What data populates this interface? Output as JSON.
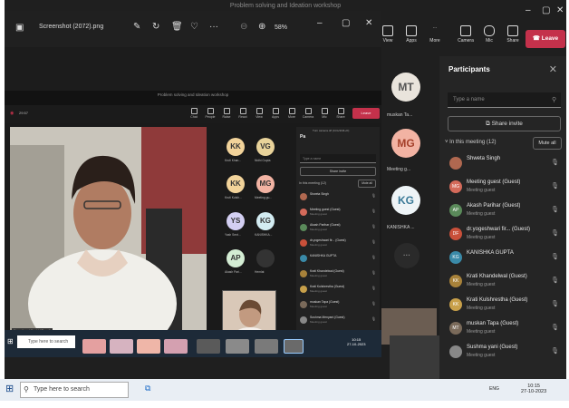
{
  "teams": {
    "title": "Problem solving and Ideation workshop",
    "toolbar": [
      {
        "label": "View"
      },
      {
        "label": "Apps"
      },
      {
        "label": "More"
      },
      {
        "label": "Camera"
      },
      {
        "label": "Mic"
      },
      {
        "label": "Share"
      }
    ],
    "leave": "Leave"
  },
  "big_avatars": [
    {
      "initials": "MT",
      "name": "muskan Ta...",
      "color": "#e9e4dc"
    },
    {
      "initials": "MG",
      "name": "Meeting g...",
      "color": "#f2b3a3"
    },
    {
      "initials": "KG",
      "name": "KANISHKA ...",
      "color": "#eef4f7"
    }
  ],
  "participants": {
    "title": "Participants",
    "search_placeholder": "Type a name",
    "share_invite": "Share invite",
    "in_meeting": "In this meeting (12)",
    "mute_all": "Mute all",
    "rows": [
      {
        "name": "Shweta Singh",
        "role": "",
        "initials": "",
        "color": "#b06850"
      },
      {
        "name": "Meeting guest (Guest)",
        "role": "Meeting guest",
        "initials": "MG",
        "color": "#d46a5a"
      },
      {
        "name": "Akash Parihar (Guest)",
        "role": "Meeting guest",
        "initials": "AP",
        "color": "#5a8a5a"
      },
      {
        "name": "dr.yogeshwari fir... (Guest)",
        "role": "Meeting guest",
        "initials": "DF",
        "color": "#c9503a"
      },
      {
        "name": "KANISHKA GUPTA",
        "role": "",
        "initials": "KG",
        "color": "#3a8aa8"
      },
      {
        "name": "Krati Khandelwal (Guest)",
        "role": "Meeting guest",
        "initials": "KK",
        "color": "#a8823a"
      },
      {
        "name": "Krati Kulshrestha (Guest)",
        "role": "Meeting guest",
        "initials": "KK",
        "color": "#c8a04a"
      },
      {
        "name": "muskan Tapa (Guest)",
        "role": "Meeting guest",
        "initials": "MT",
        "color": "#7a6a5a"
      },
      {
        "name": "Sushma yani (Guest)",
        "role": "Meeting guest",
        "initials": "",
        "color": "#888"
      }
    ]
  },
  "photos": {
    "filename": "Screenshot (2072).png",
    "zoom": "58%"
  },
  "inner": {
    "title": "Problem solving and Ideation workshop",
    "time": "29:57",
    "toolbar": [
      "Chat",
      "People",
      "Raise",
      "React",
      "View",
      "Apps",
      "More",
      "Camera",
      "Mic",
      "Share"
    ],
    "leave": "Leave",
    "video_name": "Yogeshwari Yogisi (Guest)",
    "avatars": [
      {
        "initials": "KK",
        "name": "Kruti Khan...",
        "color": "#f2d39a"
      },
      {
        "initials": "VG",
        "name": "Nidhi Gupta",
        "color": "#e9d39a"
      },
      {
        "initials": "KK",
        "name": "Kruti Kulsh...",
        "color": "#f2d39a"
      },
      {
        "initials": "MG",
        "name": "Meeting gu...",
        "color": "#f2b3a3"
      },
      {
        "initials": "YS",
        "name": "Yash Sent...",
        "color": "#d3cff2"
      },
      {
        "initials": "KG",
        "name": "KANISHKA...",
        "color": "#d3ecf2"
      },
      {
        "initials": "AP",
        "name": "Akash Pari...",
        "color": "#d3ecd3"
      },
      {
        "initials": "",
        "name": "Hemlat",
        "color": "#333"
      }
    ],
    "panel": {
      "header": "Turn camera off (Ctrl+Shift+O)",
      "title": "Pa",
      "search": "Type a name",
      "invite": "Share invite",
      "in_meeting": "In this meeting (12)",
      "mute_all": "Mute all",
      "rows": [
        {
          "name": "Shweta Singh",
          "role": ""
        },
        {
          "name": "Meeting guest (Guest)",
          "role": "Meeting guest"
        },
        {
          "name": "Akash Parihar (Guest)",
          "role": "Meeting guest"
        },
        {
          "name": "dr.yogeshwari fir... (Guest)",
          "role": "Meeting guest"
        },
        {
          "name": "KANISHKA GUPTA",
          "role": ""
        },
        {
          "name": "Krati Khandelwal (Guest)",
          "role": "Meeting guest"
        },
        {
          "name": "Krati Kulshrestha (Guest)",
          "role": "Meeting guest"
        },
        {
          "name": "muskan Tapa (Guest)",
          "role": "Meeting guest"
        },
        {
          "name": "Sushma Menyani (Guest)",
          "role": "Meeting guest"
        }
      ]
    },
    "taskbar_search": "Type here to search",
    "clock": "10:15",
    "date": "27-10-2023"
  },
  "outer_taskbar": {
    "search": "Type here to search",
    "lang": "ENG",
    "time": "10:15",
    "date": "27-10-2023"
  }
}
